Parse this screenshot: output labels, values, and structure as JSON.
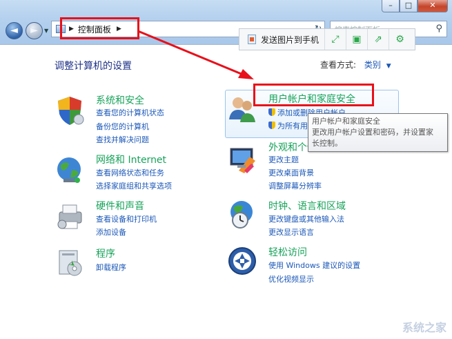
{
  "window": {
    "min_symbol": "–",
    "max_symbol": "□",
    "close_symbol": "✕"
  },
  "nav": {
    "back_symbol": "◄",
    "forward_symbol": "►"
  },
  "address": {
    "path": "控制面板"
  },
  "search": {
    "placeholder": "搜索控制面板"
  },
  "toolbar": {
    "send_label": "发送图片到手机"
  },
  "heading": "调整计算机的设置",
  "view": {
    "label": "查看方式:",
    "value": "类别"
  },
  "categories": [
    {
      "title": "系统和安全",
      "links": [
        "查看您的计算机状态",
        "备份您的计算机",
        "查找并解决问题"
      ]
    },
    {
      "title": "网络和 Internet",
      "links": [
        "查看网络状态和任务",
        "选择家庭组和共享选项"
      ]
    },
    {
      "title": "硬件和声音",
      "links": [
        "查看设备和打印机",
        "添加设备"
      ]
    },
    {
      "title": "程序",
      "links": [
        "卸载程序"
      ]
    },
    {
      "title": "用户帐户和家庭安全",
      "links": [
        "添加或删除用户帐户",
        "为所有用户设置家长控制"
      ]
    },
    {
      "title": "外观和个性化",
      "links": [
        "更改主题",
        "更改桌面背景",
        "调整屏幕分辨率"
      ]
    },
    {
      "title": "时钟、语言和区域",
      "links": [
        "更改键盘或其他输入法",
        "更改显示语言"
      ]
    },
    {
      "title": "轻松访问",
      "links": [
        "使用 Windows 建议的设置",
        "优化视频显示"
      ]
    }
  ],
  "tooltip": {
    "line1": "用户帐户和家庭安全",
    "line2": "更改用户帐户设置和密码，并设置家",
    "line3": "长控制。"
  },
  "watermark": "系统之家",
  "colors": {
    "title_green": "#17a35a",
    "link_blue": "#1b58b8",
    "annotation_red": "#e8101a"
  }
}
